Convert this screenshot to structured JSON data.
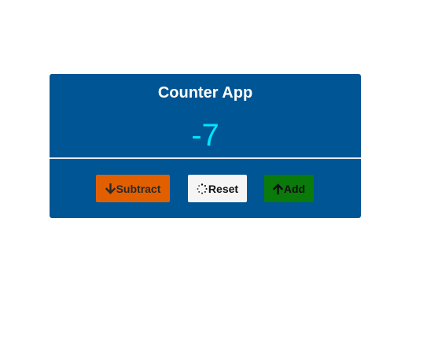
{
  "app": {
    "title": "Counter App",
    "count": "-7"
  },
  "buttons": {
    "subtract_label": "Subtract",
    "reset_label": "Reset",
    "add_label": "Add"
  },
  "icons": {
    "subtract": "arrow-down-icon",
    "reset": "spinner-icon",
    "add": "arrow-up-icon"
  },
  "colors": {
    "card_background": "#005594",
    "count_text": "#00e5ff",
    "subtract_button": "#e25f00",
    "reset_button": "#f5f5f5",
    "add_button": "#0a7a0a"
  }
}
